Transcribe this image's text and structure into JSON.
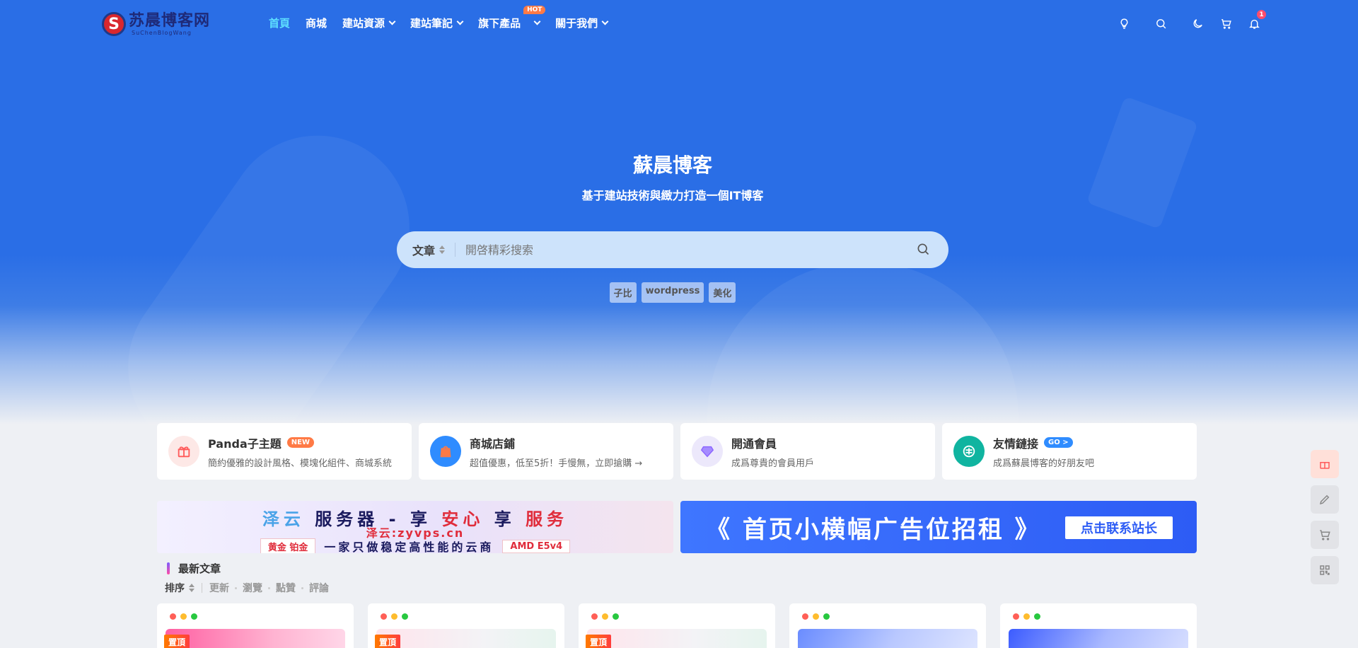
{
  "logo": {
    "title": "苏晨博客网",
    "subtitle": "SuChenBlogWang",
    "mark": "S"
  },
  "nav": {
    "items": [
      {
        "label": "首頁",
        "active": true,
        "dropdown": false
      },
      {
        "label": "商城",
        "active": false,
        "dropdown": false
      },
      {
        "label": "建站資源",
        "active": false,
        "dropdown": true
      },
      {
        "label": "建站筆記",
        "active": false,
        "dropdown": true
      },
      {
        "label": "旗下產品",
        "active": false,
        "dropdown": true,
        "badge": "HOT"
      },
      {
        "label": "關于我們",
        "active": false,
        "dropdown": true
      }
    ],
    "tools": [
      "lightbulb-icon",
      "search-icon",
      "moon-icon",
      "cart-icon",
      "bell-icon"
    ],
    "notification_count": "1"
  },
  "hero": {
    "title": "蘇晨博客",
    "subtitle": "基于建站技術與緻力打造一個IT博客"
  },
  "search": {
    "type_label": "文章",
    "placeholder": "開啓精彩搜索"
  },
  "tags": [
    "子比",
    "wordpress",
    "美化"
  ],
  "features": [
    {
      "title": "Panda子主題",
      "badge": "NEW",
      "desc": "簡約優雅的設計風格、模塊化組件、商城系統",
      "icon": "gift-icon",
      "icon_bg": "#fde8e6",
      "icon_color": "#ff5a5a",
      "badge_color": "#ff7a45"
    },
    {
      "title": "商城店鋪",
      "badge": "",
      "desc": "超值優惠，低至5折！手慢無，立即搶購 →",
      "icon": "shop-icon",
      "icon_bg": "#2f8cff",
      "icon_color": "#ff7a45",
      "badge_color": ""
    },
    {
      "title": "開通會員",
      "badge": "",
      "desc": "成爲尊貴的會員用戶",
      "icon": "diamond-icon",
      "icon_bg": "#ece8fb",
      "icon_color": "#8a63ff",
      "badge_color": ""
    },
    {
      "title": "友情鏈接",
      "badge": "GO >",
      "desc": "成爲蘇晨博客的好朋友吧",
      "icon": "link-icon",
      "icon_bg": "#10b4a0",
      "icon_color": "#ffffff",
      "badge_color": "#2f8cff"
    }
  ],
  "banner_left": {
    "line1": [
      "泽云",
      "服务器",
      "-",
      "享",
      "安心",
      "享",
      "服务"
    ],
    "line2": "泽云:zyvps.cn",
    "tier": "黄金 铂金",
    "slogan": "一家只做稳定高性能的云商",
    "spec": "AMD E5v4"
  },
  "banner_right": {
    "text": "《 首页小横幅广告位招租 》",
    "button": "点击联系站长"
  },
  "latest": {
    "title": "最新文章",
    "sort_label": "排序",
    "sort_options": [
      "更新",
      "瀏覽",
      "點贊",
      "評論"
    ]
  },
  "cards": [
    {
      "pin": "置頂",
      "thumb": "linear-gradient(90deg,#ff5fa2,#ffb3d1 60%,#ffd6e8)"
    },
    {
      "pin": "置頂",
      "thumb": "linear-gradient(90deg,#ffe4ec,#f3f3f6 60%,#e6f4ee)"
    },
    {
      "pin": "置頂",
      "thumb": "linear-gradient(90deg,#ffe4ec,#f3f3f6 60%,#e6f4ee)"
    },
    {
      "pin": "",
      "thumb": "linear-gradient(120deg,#6a8cff,#b9c8ff 50%,#e2e8ff)"
    },
    {
      "pin": "",
      "thumb": "linear-gradient(120deg,#3c5cff,#a8b8ff 50%,#dde3ff)"
    }
  ],
  "float_buttons": [
    "gift-icon",
    "edit-icon",
    "cart-icon",
    "qrcode-icon"
  ],
  "colors": {
    "primary": "#2a6ee6",
    "accent": "#5ee0ff",
    "hot": "#ff7a45"
  }
}
